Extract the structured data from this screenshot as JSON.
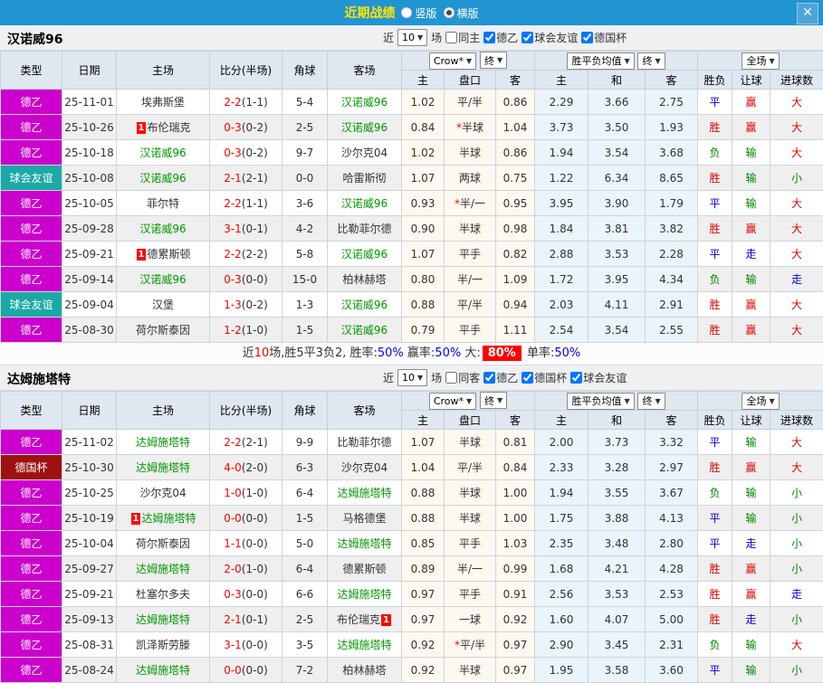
{
  "titlebar": {
    "title": "近期战绩",
    "radios": [
      {
        "label": "竖版",
        "checked": false
      },
      {
        "label": "横版",
        "checked": true
      }
    ],
    "close_icon": "✕"
  },
  "colors": {
    "topbar": "#2195d2",
    "title_yellow": "#ffe400",
    "league": {
      "德乙": "#cc00cc",
      "球会友谊": "#1aa9a4",
      "德国杯": "#9e1111"
    },
    "r": "#e60000",
    "b": "#0000e6",
    "g": "#008800",
    "team_active": "#009900",
    "score_red": "#ff0000",
    "badge_red": "#ff0000"
  },
  "table_headers": {
    "cols": [
      "类型",
      "日期",
      "主场",
      "比分(半场)",
      "角球",
      "客场"
    ],
    "subcols": [
      "主",
      "盘口",
      "客",
      "主",
      "和",
      "客",
      "胜负",
      "让球",
      "进球数"
    ],
    "company_select": "Crow*",
    "stage_select": "终",
    "avg_select": "胜平负均值",
    "avg_stage_select": "终",
    "scope_select": "全场"
  },
  "sections": [
    {
      "team": "汉诺威96",
      "filter": {
        "near": "近",
        "count": "10",
        "games": "场",
        "same_label": "同主",
        "same_checked": false,
        "leagues": [
          {
            "label": "德乙",
            "checked": true
          },
          {
            "label": "球会友谊",
            "checked": true
          },
          {
            "label": "德国杯",
            "checked": true
          }
        ]
      },
      "rows": [
        {
          "lg": "德乙",
          "date": "25-11-01",
          "home": "埃弗斯堡",
          "ha": 0,
          "hb": 0,
          "score": "2-2",
          "half": "(1-1)",
          "cor": "5-4",
          "away": "汉诺威96",
          "aa": 1,
          "ab": 0,
          "o1": "1.02",
          "pan": "平/半",
          "star": 0,
          "o2": "0.86",
          "a1": "2.29",
          "a2": "3.66",
          "a3": "2.75",
          "r1": "平",
          "c1": "b",
          "r2": "赢",
          "c2": "r",
          "r3": "大",
          "c3": "r"
        },
        {
          "lg": "德乙",
          "date": "25-10-26",
          "home": "布伦瑞克",
          "ha": 0,
          "hb": 1,
          "score": "0-3",
          "half": "(0-2)",
          "cor": "2-5",
          "away": "汉诺威96",
          "aa": 1,
          "ab": 0,
          "o1": "0.84",
          "pan": "半球",
          "star": 1,
          "o2": "1.04",
          "a1": "3.73",
          "a2": "3.50",
          "a3": "1.93",
          "r1": "胜",
          "c1": "r",
          "r2": "赢",
          "c2": "r",
          "r3": "大",
          "c3": "r"
        },
        {
          "lg": "德乙",
          "date": "25-10-18",
          "home": "汉诺威96",
          "ha": 1,
          "hb": 0,
          "score": "0-3",
          "half": "(0-2)",
          "cor": "9-7",
          "away": "沙尔克04",
          "aa": 0,
          "ab": 0,
          "o1": "1.02",
          "pan": "半球",
          "star": 0,
          "o2": "0.86",
          "a1": "1.94",
          "a2": "3.54",
          "a3": "3.68",
          "r1": "负",
          "c1": "g",
          "r2": "输",
          "c2": "g",
          "r3": "大",
          "c3": "r"
        },
        {
          "lg": "球会友谊",
          "date": "25-10-08",
          "home": "汉诺威96",
          "ha": 1,
          "hb": 0,
          "score": "2-1",
          "half": "(2-1)",
          "cor": "0-0",
          "away": "哈雷斯彻",
          "aa": 0,
          "ab": 0,
          "o1": "1.07",
          "pan": "两球",
          "star": 0,
          "o2": "0.75",
          "a1": "1.22",
          "a2": "6.34",
          "a3": "8.65",
          "r1": "胜",
          "c1": "r",
          "r2": "输",
          "c2": "g",
          "r3": "小",
          "c3": "g"
        },
        {
          "lg": "德乙",
          "date": "25-10-05",
          "home": "菲尔特",
          "ha": 0,
          "hb": 0,
          "score": "2-2",
          "half": "(1-1)",
          "cor": "3-6",
          "away": "汉诺威96",
          "aa": 1,
          "ab": 0,
          "o1": "0.93",
          "pan": "半/一",
          "star": 1,
          "o2": "0.95",
          "a1": "3.95",
          "a2": "3.90",
          "a3": "1.79",
          "r1": "平",
          "c1": "b",
          "r2": "输",
          "c2": "g",
          "r3": "大",
          "c3": "r"
        },
        {
          "lg": "德乙",
          "date": "25-09-28",
          "home": "汉诺威96",
          "ha": 1,
          "hb": 0,
          "score": "3-1",
          "half": "(0-1)",
          "cor": "4-2",
          "away": "比勒菲尔德",
          "aa": 0,
          "ab": 0,
          "o1": "0.90",
          "pan": "半球",
          "star": 0,
          "o2": "0.98",
          "a1": "1.84",
          "a2": "3.81",
          "a3": "3.82",
          "r1": "胜",
          "c1": "r",
          "r2": "赢",
          "c2": "r",
          "r3": "大",
          "c3": "r"
        },
        {
          "lg": "德乙",
          "date": "25-09-21",
          "home": "德累斯顿",
          "ha": 0,
          "hb": 1,
          "score": "2-2",
          "half": "(2-2)",
          "cor": "5-8",
          "away": "汉诺威96",
          "aa": 1,
          "ab": 0,
          "o1": "1.07",
          "pan": "平手",
          "star": 0,
          "o2": "0.82",
          "a1": "2.88",
          "a2": "3.53",
          "a3": "2.28",
          "r1": "平",
          "c1": "b",
          "r2": "走",
          "c2": "b",
          "r3": "大",
          "c3": "r"
        },
        {
          "lg": "德乙",
          "date": "25-09-14",
          "home": "汉诺威96",
          "ha": 1,
          "hb": 0,
          "score": "0-3",
          "half": "(0-0)",
          "cor": "15-0",
          "away": "柏林赫塔",
          "aa": 0,
          "ab": 0,
          "o1": "0.80",
          "pan": "半/一",
          "star": 0,
          "o2": "1.09",
          "a1": "1.72",
          "a2": "3.95",
          "a3": "4.34",
          "r1": "负",
          "c1": "g",
          "r2": "输",
          "c2": "g",
          "r3": "走",
          "c3": "b"
        },
        {
          "lg": "球会友谊",
          "date": "25-09-04",
          "home": "汉堡",
          "ha": 0,
          "hb": 0,
          "score": "1-3",
          "half": "(0-2)",
          "cor": "1-3",
          "away": "汉诺威96",
          "aa": 1,
          "ab": 0,
          "o1": "0.88",
          "pan": "平/半",
          "star": 0,
          "o2": "0.94",
          "a1": "2.03",
          "a2": "4.11",
          "a3": "2.91",
          "r1": "胜",
          "c1": "r",
          "r2": "赢",
          "c2": "r",
          "r3": "大",
          "c3": "r"
        },
        {
          "lg": "德乙",
          "date": "25-08-30",
          "home": "荷尔斯泰因",
          "ha": 0,
          "hb": 0,
          "score": "1-2",
          "half": "(1-0)",
          "cor": "1-5",
          "away": "汉诺威96",
          "aa": 1,
          "ab": 0,
          "o1": "0.79",
          "pan": "平手",
          "star": 0,
          "o2": "1.11",
          "a1": "2.54",
          "a2": "3.54",
          "a3": "2.55",
          "r1": "胜",
          "c1": "r",
          "r2": "赢",
          "c2": "r",
          "r3": "大",
          "c3": "r"
        }
      ],
      "summary": [
        {
          "t": "近",
          "s": "plain"
        },
        {
          "t": "10",
          "s": "red"
        },
        {
          "t": "场,胜5平3负2, 胜率:",
          "s": "plain"
        },
        {
          "t": "50%",
          "s": "blue"
        },
        {
          "t": " 赢率:",
          "s": "plain"
        },
        {
          "t": "50%",
          "s": "blue"
        },
        {
          "t": " 大:",
          "s": "plain"
        },
        {
          "t": "80%",
          "s": "badge"
        },
        {
          "t": " 单率:",
          "s": "plain"
        },
        {
          "t": "50%",
          "s": "blue"
        }
      ]
    },
    {
      "team": "达姆施塔特",
      "filter": {
        "near": "近",
        "count": "10",
        "games": "场",
        "same_label": "同客",
        "same_checked": false,
        "leagues": [
          {
            "label": "德乙",
            "checked": true
          },
          {
            "label": "德国杯",
            "checked": true
          },
          {
            "label": "球会友谊",
            "checked": true
          }
        ]
      },
      "rows": [
        {
          "lg": "德乙",
          "date": "25-11-02",
          "home": "达姆施塔特",
          "ha": 1,
          "hb": 0,
          "score": "2-2",
          "half": "(2-1)",
          "cor": "9-9",
          "away": "比勒菲尔德",
          "aa": 0,
          "ab": 0,
          "o1": "1.07",
          "pan": "半球",
          "star": 0,
          "o2": "0.81",
          "a1": "2.00",
          "a2": "3.73",
          "a3": "3.32",
          "r1": "平",
          "c1": "b",
          "r2": "输",
          "c2": "g",
          "r3": "大",
          "c3": "r"
        },
        {
          "lg": "德国杯",
          "date": "25-10-30",
          "home": "达姆施塔特",
          "ha": 1,
          "hb": 0,
          "score": "4-0",
          "half": "(2-0)",
          "cor": "6-3",
          "away": "沙尔克04",
          "aa": 0,
          "ab": 0,
          "o1": "1.04",
          "pan": "平/半",
          "star": 0,
          "o2": "0.84",
          "a1": "2.33",
          "a2": "3.28",
          "a3": "2.97",
          "r1": "胜",
          "c1": "r",
          "r2": "赢",
          "c2": "r",
          "r3": "大",
          "c3": "r"
        },
        {
          "lg": "德乙",
          "date": "25-10-25",
          "home": "沙尔克04",
          "ha": 0,
          "hb": 0,
          "score": "1-0",
          "half": "(1-0)",
          "cor": "6-4",
          "away": "达姆施塔特",
          "aa": 1,
          "ab": 0,
          "o1": "0.88",
          "pan": "半球",
          "star": 0,
          "o2": "1.00",
          "a1": "1.94",
          "a2": "3.55",
          "a3": "3.67",
          "r1": "负",
          "c1": "g",
          "r2": "输",
          "c2": "g",
          "r3": "小",
          "c3": "g"
        },
        {
          "lg": "德乙",
          "date": "25-10-19",
          "home": "达姆施塔特",
          "ha": 1,
          "hb": 1,
          "score": "0-0",
          "half": "(0-0)",
          "cor": "1-5",
          "away": "马格德堡",
          "aa": 0,
          "ab": 0,
          "o1": "0.88",
          "pan": "半球",
          "star": 0,
          "o2": "1.00",
          "a1": "1.75",
          "a2": "3.88",
          "a3": "4.13",
          "r1": "平",
          "c1": "b",
          "r2": "输",
          "c2": "g",
          "r3": "小",
          "c3": "g"
        },
        {
          "lg": "德乙",
          "date": "25-10-04",
          "home": "荷尔斯泰因",
          "ha": 0,
          "hb": 0,
          "score": "1-1",
          "half": "(0-0)",
          "cor": "5-0",
          "away": "达姆施塔特",
          "aa": 1,
          "ab": 0,
          "o1": "0.85",
          "pan": "平手",
          "star": 0,
          "o2": "1.03",
          "a1": "2.35",
          "a2": "3.48",
          "a3": "2.80",
          "r1": "平",
          "c1": "b",
          "r2": "走",
          "c2": "b",
          "r3": "小",
          "c3": "g"
        },
        {
          "lg": "德乙",
          "date": "25-09-27",
          "home": "达姆施塔特",
          "ha": 1,
          "hb": 0,
          "score": "2-0",
          "half": "(1-0)",
          "cor": "6-4",
          "away": "德累斯顿",
          "aa": 0,
          "ab": 0,
          "o1": "0.89",
          "pan": "半/一",
          "star": 0,
          "o2": "0.99",
          "a1": "1.68",
          "a2": "4.21",
          "a3": "4.28",
          "r1": "胜",
          "c1": "r",
          "r2": "赢",
          "c2": "r",
          "r3": "小",
          "c3": "g"
        },
        {
          "lg": "德乙",
          "date": "25-09-21",
          "home": "杜塞尔多夫",
          "ha": 0,
          "hb": 0,
          "score": "0-3",
          "half": "(0-0)",
          "cor": "6-6",
          "away": "达姆施塔特",
          "aa": 1,
          "ab": 0,
          "o1": "0.97",
          "pan": "平手",
          "star": 0,
          "o2": "0.91",
          "a1": "2.56",
          "a2": "3.53",
          "a3": "2.53",
          "r1": "胜",
          "c1": "r",
          "r2": "赢",
          "c2": "r",
          "r3": "走",
          "c3": "b"
        },
        {
          "lg": "德乙",
          "date": "25-09-13",
          "home": "达姆施塔特",
          "ha": 1,
          "hb": 0,
          "score": "2-1",
          "half": "(0-1)",
          "cor": "2-5",
          "away": "布伦瑞克",
          "aa": 0,
          "ab": 1,
          "o1": "0.97",
          "pan": "一球",
          "star": 0,
          "o2": "0.92",
          "a1": "1.60",
          "a2": "4.07",
          "a3": "5.00",
          "r1": "胜",
          "c1": "r",
          "r2": "走",
          "c2": "b",
          "r3": "小",
          "c3": "g"
        },
        {
          "lg": "德乙",
          "date": "25-08-31",
          "home": "凯泽斯劳滕",
          "ha": 0,
          "hb": 0,
          "score": "3-1",
          "half": "(0-0)",
          "cor": "3-5",
          "away": "达姆施塔特",
          "aa": 1,
          "ab": 0,
          "o1": "0.92",
          "pan": "平/半",
          "star": 1,
          "o2": "0.97",
          "a1": "2.90",
          "a2": "3.45",
          "a3": "2.31",
          "r1": "负",
          "c1": "g",
          "r2": "输",
          "c2": "g",
          "r3": "大",
          "c3": "r"
        },
        {
          "lg": "德乙",
          "date": "25-08-24",
          "home": "达姆施塔特",
          "ha": 1,
          "hb": 0,
          "score": "0-0",
          "half": "(0-0)",
          "cor": "7-2",
          "away": "柏林赫塔",
          "aa": 0,
          "ab": 0,
          "o1": "0.92",
          "pan": "半球",
          "star": 0,
          "o2": "0.97",
          "a1": "1.95",
          "a2": "3.58",
          "a3": "3.60",
          "r1": "平",
          "c1": "b",
          "r2": "输",
          "c2": "g",
          "r3": "小",
          "c3": "g"
        }
      ]
    }
  ]
}
